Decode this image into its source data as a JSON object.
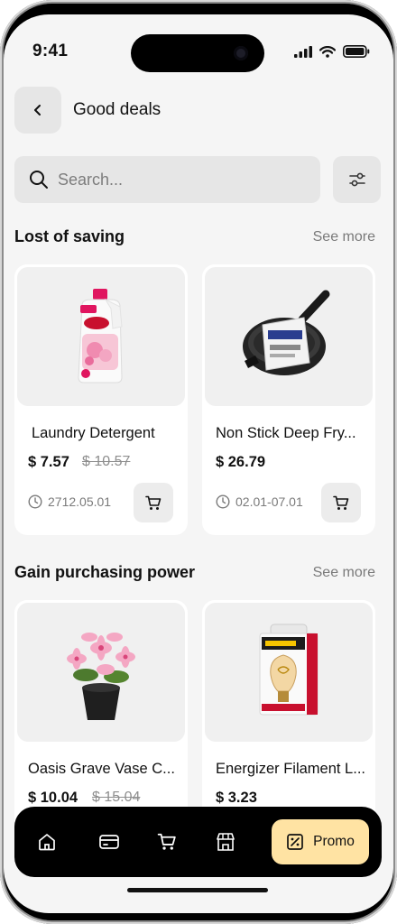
{
  "status_bar": {
    "time": "9:41"
  },
  "header": {
    "title": "Good deals"
  },
  "search": {
    "placeholder": "Search..."
  },
  "sections": [
    {
      "title": "Lost of saving",
      "see_more": "See more",
      "products": [
        {
          "name": "Laundry Detergent",
          "price": "$ 7.57",
          "old_price": "$ 10.57",
          "date": "2712.05.01",
          "image": "detergent-bottle"
        },
        {
          "name": "Non Stick Deep Fry...",
          "price": "$ 26.79",
          "old_price": "",
          "date": "02.01-07.01",
          "image": "frying-pan"
        }
      ]
    },
    {
      "title": "Gain purchasing power",
      "see_more": "See more",
      "products": [
        {
          "name": "Oasis Grave Vase C...",
          "price": "$ 10.04",
          "old_price": "$ 15.04",
          "image": "flower-vase"
        },
        {
          "name": "Energizer Filament L...",
          "price": "$ 3.23",
          "old_price": "",
          "image": "light-bulb-box"
        }
      ]
    }
  ],
  "bottom_nav": {
    "items": [
      "home-icon",
      "card-icon",
      "cart-icon",
      "store-icon"
    ],
    "promo_label": "Promo"
  },
  "colors": {
    "background": "#f5f5f5",
    "promo_accent": "#ffe3a3",
    "nav_background": "#000000"
  }
}
